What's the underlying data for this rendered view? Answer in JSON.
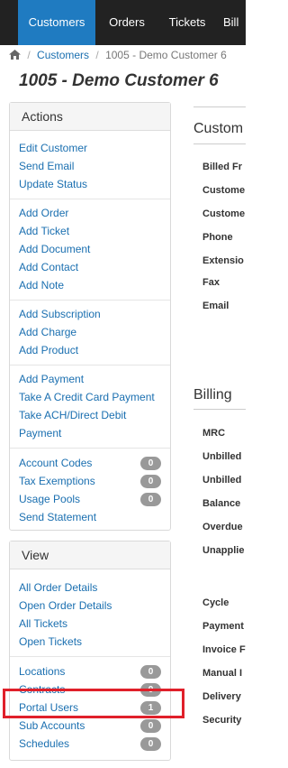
{
  "nav": {
    "items": [
      {
        "label": "Customers",
        "active": true
      },
      {
        "label": "Orders",
        "active": false
      },
      {
        "label": "Tickets",
        "active": false
      },
      {
        "label": "Bill",
        "active": false
      }
    ]
  },
  "breadcrumb": {
    "icon": "home-icon",
    "items": [
      "Customers",
      "1005 - Demo Customer 6"
    ]
  },
  "page_title": "1005 - Demo Customer 6",
  "actions": {
    "title": "Actions",
    "groups": [
      [
        "Edit Customer",
        "Send Email",
        "Update Status"
      ],
      [
        "Add Order",
        "Add Ticket",
        "Add Document",
        "Add Contact",
        "Add Note"
      ],
      [
        "Add Subscription",
        "Add Charge",
        "Add Product"
      ],
      [
        "Add Payment",
        "Take A Credit Card Payment",
        "Take ACH/Direct Debit Payment"
      ],
      [
        "Account Codes",
        "Tax Exemptions",
        "Usage Pools",
        "Send Statement"
      ]
    ],
    "badges": {
      "account_codes": "0",
      "tax_exemptions": "0",
      "usage_pools": "0"
    }
  },
  "view": {
    "title": "View",
    "groups": [
      [
        "All Order Details",
        "Open Order Details",
        "All Tickets",
        "Open Tickets"
      ],
      [
        "Locations",
        "Contracts",
        "Portal Users",
        "Sub Accounts",
        "Schedules"
      ]
    ],
    "badges": {
      "locations": "0",
      "contracts": "0",
      "portal_users": "1",
      "sub_accounts": "0",
      "schedules": "0"
    }
  },
  "customer_section": {
    "title": "Custom",
    "fields": [
      "Billed Fr",
      "Custome",
      "Custome",
      "Phone",
      "Extensio",
      "Fax",
      "Email"
    ]
  },
  "billing_section": {
    "title": "Billing",
    "fields": [
      "MRC",
      "Unbilled",
      "Unbilled",
      "Balance",
      "Overdue",
      "Unapplie"
    ],
    "fields2": [
      "Cycle",
      "Payment",
      "Invoice F",
      "Manual I",
      "Delivery",
      "Security"
    ]
  },
  "colors": {
    "nav_bg": "#222222",
    "nav_active": "#1f7bc1",
    "link": "#1a6fb0",
    "highlight": "#e0202a"
  }
}
